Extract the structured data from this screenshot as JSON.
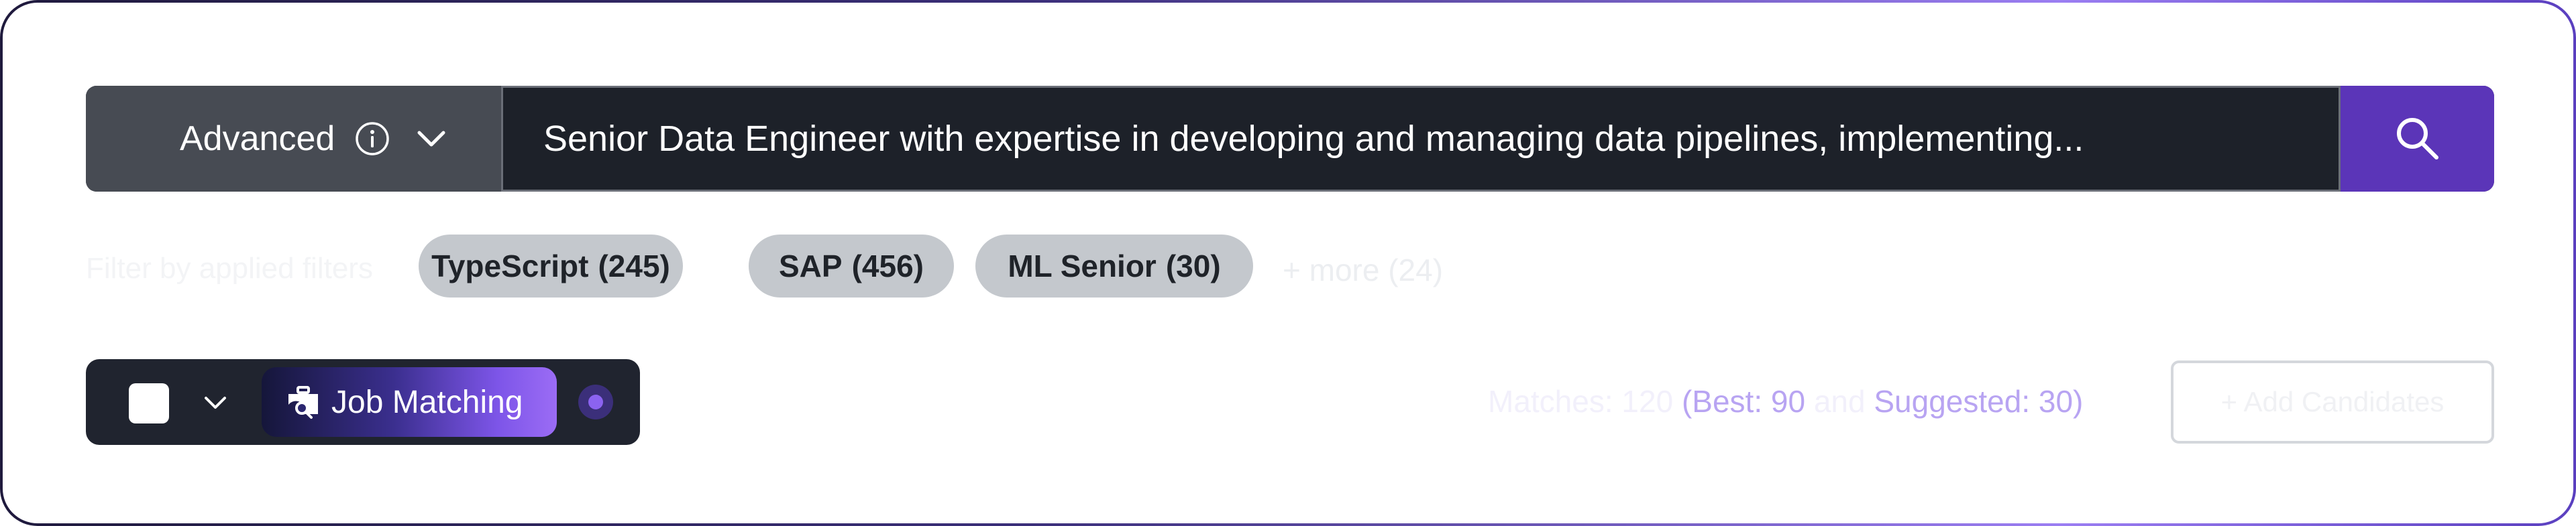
{
  "search": {
    "mode_label": "Advanced",
    "query": "Senior Data Engineer with expertise in developing and managing data pipelines, implementing..."
  },
  "tags_row": {
    "hint": "Filter by applied filters",
    "tags": [
      {
        "name": "TypeScript",
        "count": "(245)"
      },
      {
        "name": "SAP",
        "count": "(456)"
      },
      {
        "name": "ML Senior",
        "count": "(30)"
      }
    ],
    "more": "+ more (24)"
  },
  "toolbar": {
    "job_matching_label": "Job Matching"
  },
  "matches": {
    "prefix": "Matches: 120",
    "best": "(Best: 90",
    "sep": "and",
    "suggested": "Suggested: 30)"
  },
  "add_button_label": "+ Add Candidates",
  "colors": {
    "accent": "#5b35b8",
    "search_bg": "#1d2129",
    "mode_bg": "#474b53",
    "tag_bg": "#c4c8cd",
    "toolbar_bg": "#20242f"
  },
  "icons": {
    "info": "info-icon",
    "chevron": "chevron-down-icon",
    "search": "search-icon",
    "job_matching": "briefcase-search-icon"
  }
}
